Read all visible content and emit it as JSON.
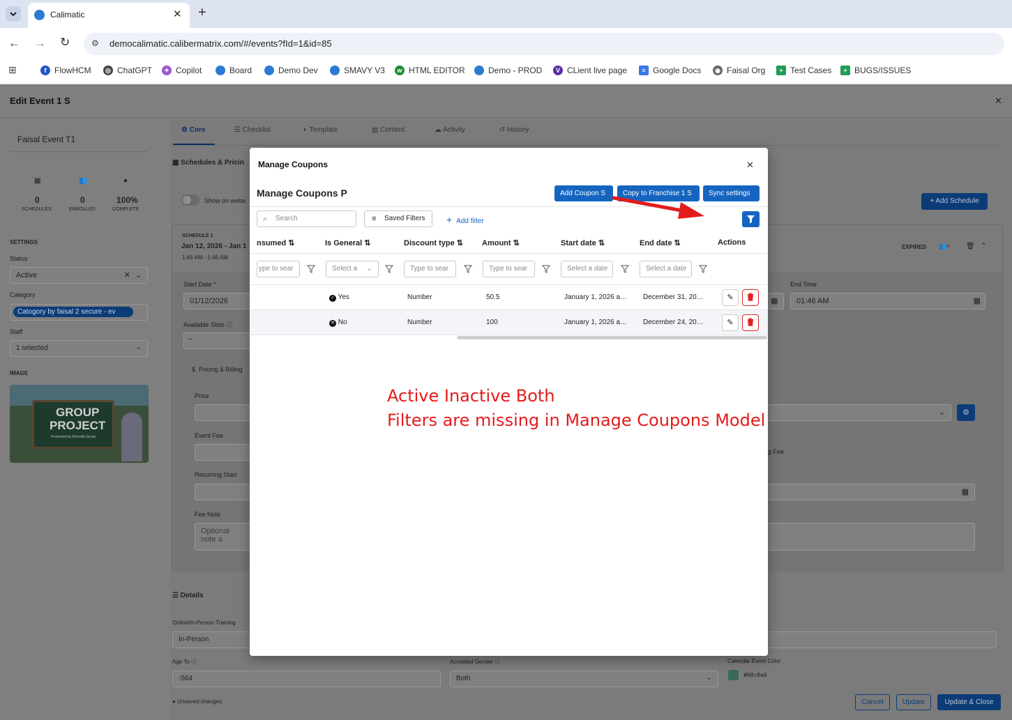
{
  "browser": {
    "tab_title": "Calimatic",
    "url": "democalimatic.calibermatrix.com/#/events?fId=1&id=85",
    "bookmarks": [
      "FlowHCM",
      "ChatGPT",
      "Copilot",
      "Board",
      "Demo Dev",
      "SMAVY V3",
      "HTML EDITOR",
      "Demo - PROD",
      "CLient live page",
      "Google Docs",
      "Faisal Org",
      "Test Cases",
      "BUGS/ISSUES"
    ]
  },
  "page": {
    "title": "Edit Event 1 S",
    "event_name": "Faisal Event T1",
    "stats": [
      {
        "value": "0",
        "label": "SCHEDULES"
      },
      {
        "value": "0",
        "label": "ENROLLED"
      },
      {
        "value": "100%",
        "label": "COMPLETE"
      }
    ],
    "settings_label": "SETTINGS",
    "status_label": "Status",
    "status_value": "Active",
    "category_label": "Category",
    "category_value": "Catogory by faisal 2 secure - ev",
    "staff_label": "Staff",
    "staff_value": "1 selected",
    "image_label": "IMAGE",
    "image_title_1": "GROUP",
    "image_title_2": "PROJECT",
    "image_sub": "Presented by Borcelle Group",
    "tabs": [
      "Core",
      "Checklist",
      "Template",
      "Content",
      "Activity",
      "History"
    ],
    "schedules_heading": "Schedules & Pricin",
    "show_on_web": "Show on weba",
    "add_schedule": "+ Add Schedule",
    "schedule_label": "SCHEDULE 1",
    "schedule_dates": "Jan 12, 2026 - Jan 1",
    "schedule_times": "1:46 AM - 1:46 AM",
    "expired": "EXPIRED",
    "start_date_label": "Start Date *",
    "start_date_value": "01/12/2026",
    "end_time_label": "End Time",
    "end_time_value": "01:46 AM",
    "available_slots": "Available Slots",
    "slot_minus": "−",
    "pricing_billing": "Pricing & Billing",
    "price_label": "Price",
    "event_fee": "Event Fee",
    "recurring_start": "Recurring Start",
    "fee_note": "Fee Note",
    "fee_note_placeholder": "Optional note a",
    "fee_right": "g Fee",
    "details": "Details",
    "training_label": "Online/In-Person Training",
    "training_value": "In-Person",
    "age_to_label": "Age To",
    "age_to_value": "-564",
    "gender_label": "Accepted Gender",
    "gender_value": "Both",
    "color_label": "Calendar Event Color",
    "color_value": "#68c0a0",
    "unsaved": "Unsaved changes",
    "cancel": "Cancel",
    "update": "Update",
    "update_close": "Update & Close"
  },
  "modal": {
    "title": "Manage Coupons",
    "subtitle": "Manage Coupons P",
    "add_coupon": "Add Coupon S",
    "copy_franchise": "Copy to Franchise 1 S",
    "sync_settings": "Sync settings",
    "search_placeholder": "Search",
    "saved_filters": "Saved Filters",
    "add_filter": "Add filter",
    "columns": [
      "nsumed",
      "Is General",
      "Discount type",
      "Amount",
      "Start date",
      "End date",
      "Actions"
    ],
    "filter_placeholders": [
      "ype to sear",
      "Select a",
      "Type to sear",
      "Type to sear",
      "Select a date",
      "Select a date"
    ],
    "rows": [
      {
        "general": "Yes",
        "discount_type": "Number",
        "amount": "50.5",
        "start": "January 1, 2026 a…",
        "end": "December 31, 20…"
      },
      {
        "general": "No",
        "discount_type": "Number",
        "amount": "100",
        "start": "January 1, 2026 a…",
        "end": "December 24, 20…"
      }
    ]
  },
  "annotation": {
    "line1": "Active Inactive Both",
    "line2": "Filters are missing in Manage Coupons Model",
    "color": "#e41b1b"
  },
  "colors": {
    "primary": "#1565c0",
    "delete": "#e02424",
    "backdrop": "#7f7f7f"
  }
}
